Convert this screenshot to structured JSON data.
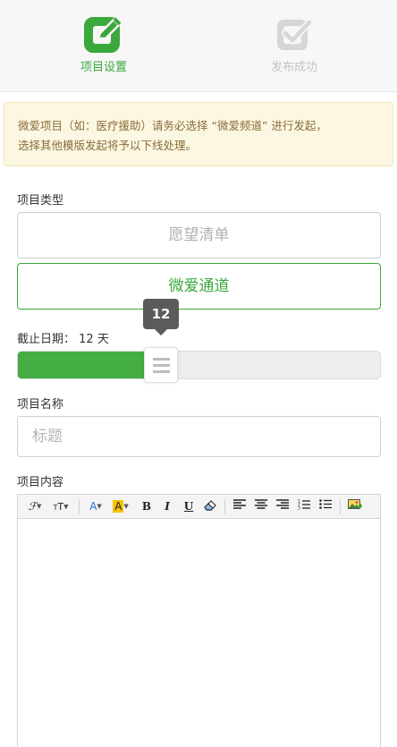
{
  "steps": [
    {
      "label": "项目设置",
      "state": "active",
      "icon": "edit-square-icon"
    },
    {
      "label": "发布成功",
      "state": "inactive",
      "icon": "check-square-icon"
    }
  ],
  "notice": {
    "line1": "微爱项目（如：医疗援助）请务必选择 “微爱频道” 进行发起，",
    "line2": "选择其他模版发起将予以下线处理。"
  },
  "project_type": {
    "label": "项目类型",
    "options": [
      "愿望清单",
      "微爱通道"
    ],
    "selected": "微爱通道"
  },
  "deadline": {
    "label": "截止日期：",
    "value": "12",
    "unit": "天",
    "tooltip": "12",
    "slider_fraction": 0.355
  },
  "project_name": {
    "label": "项目名称",
    "placeholder": "标题",
    "value": ""
  },
  "project_content": {
    "label": "项目内容",
    "toolbar": [
      "font-family-icon",
      "font-size-icon",
      "font-color-icon",
      "highlight-color-icon",
      "bold-icon",
      "italic-icon",
      "underline-icon",
      "eraser-icon",
      "align-left-icon",
      "align-center-icon",
      "align-right-icon",
      "ordered-list-icon",
      "unordered-list-icon",
      "insert-image-icon"
    ],
    "value": ""
  },
  "colors": {
    "brand_green": "#3aa83a",
    "slider_fill": "#44ad44",
    "notice_bg": "#fcf7e2",
    "notice_text": "#8a6d3b",
    "inactive_gray": "#c4c4c4"
  }
}
